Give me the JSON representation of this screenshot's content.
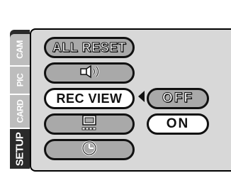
{
  "tabs": [
    {
      "label": "CAM",
      "active": false
    },
    {
      "label": "PIC",
      "active": false
    },
    {
      "label": "CARD",
      "active": false
    },
    {
      "label": "SETUP",
      "active": true
    }
  ],
  "menu": {
    "items": [
      {
        "label": "ALL RESET",
        "selected": false
      },
      {
        "icon": "beep-sound-icon",
        "selected": false
      },
      {
        "label": "REC VIEW",
        "selected": true
      },
      {
        "icon": "monitor-brightness-icon",
        "selected": false
      },
      {
        "icon": "clock-icon",
        "selected": false
      }
    ]
  },
  "options": [
    {
      "label": "OFF",
      "selected": false
    },
    {
      "label": "ON",
      "selected": true
    }
  ],
  "colors": {
    "panel_bg": "#d8d8d8",
    "inactive_pill": "#a9a9a9",
    "selected_pill": "#ffffff",
    "outline": "#111111"
  }
}
